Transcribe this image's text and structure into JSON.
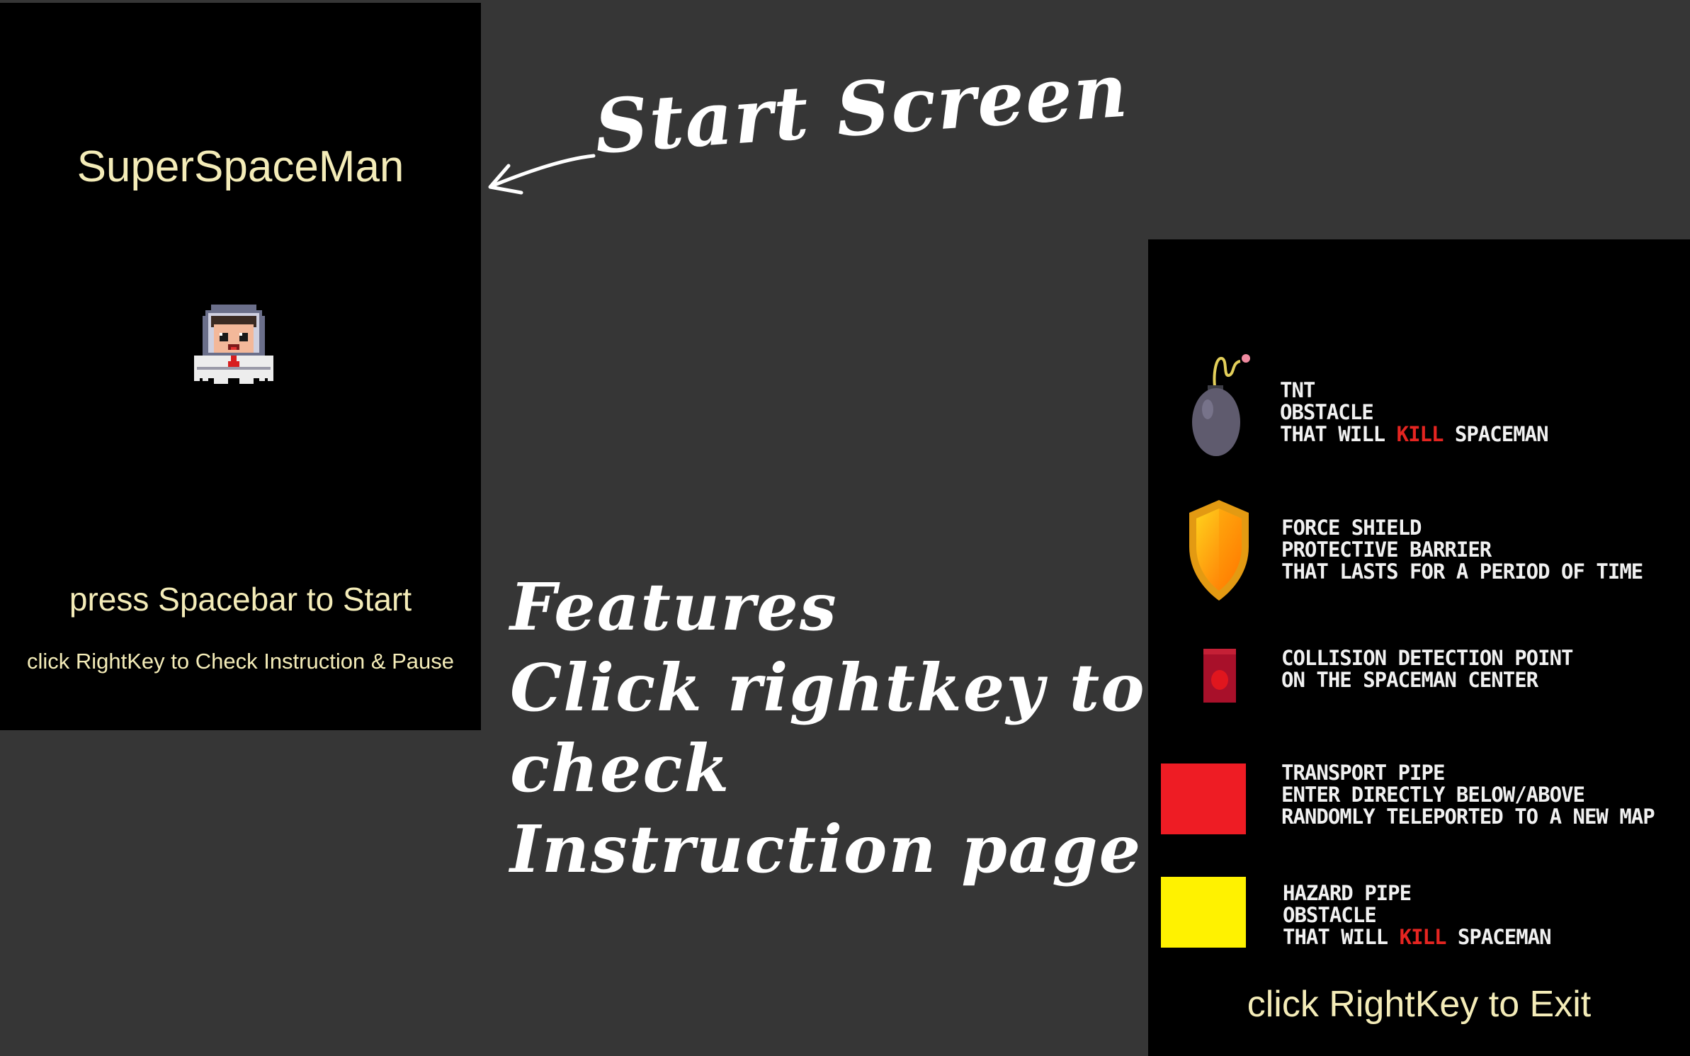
{
  "start_screen": {
    "title": "SuperSpaceMan",
    "prompt": "press Spacebar to Start",
    "hint": "click RightKey to Check Instruction & Pause"
  },
  "annotations": {
    "start_label": "Start Screen",
    "features_label": "Features\nClick rightkey to\ncheck\nInstruction page"
  },
  "instructions": {
    "items": [
      {
        "icon": "bomb-icon",
        "lines": [
          "TNT",
          "OBSTACLE"
        ],
        "kill_prefix": "THAT WILL ",
        "kill_word": "KILL",
        "kill_suffix": " SPACEMAN"
      },
      {
        "icon": "shield-icon",
        "lines": [
          "FORCE SHIELD",
          "PROTECTIVE BARRIER",
          "THAT LASTS FOR A PERIOD OF TIME"
        ]
      },
      {
        "icon": "collision-point-icon",
        "lines": [
          "COLLISION DETECTION POINT",
          "ON THE SPACEMAN CENTER"
        ]
      },
      {
        "icon": "red-pipe-icon",
        "lines": [
          "TRANSPORT PIPE",
          "ENTER DIRECTLY BELOW/ABOVE",
          "RANDOMLY TELEPORTED TO A NEW MAP"
        ]
      },
      {
        "icon": "yellow-pipe-icon",
        "lines": [
          "HAZARD PIPE",
          "OBSTACLE"
        ],
        "kill_prefix": "THAT WILL ",
        "kill_word": "KILL",
        "kill_suffix": " SPACEMAN"
      }
    ],
    "exit": "click RightKey to Exit"
  },
  "colors": {
    "background": "#363636",
    "panel": "#000000",
    "title_text": "#f4ecb8",
    "kill": "#e52521",
    "transport_pipe": "#ee1c24",
    "hazard_pipe": "#fff200"
  }
}
